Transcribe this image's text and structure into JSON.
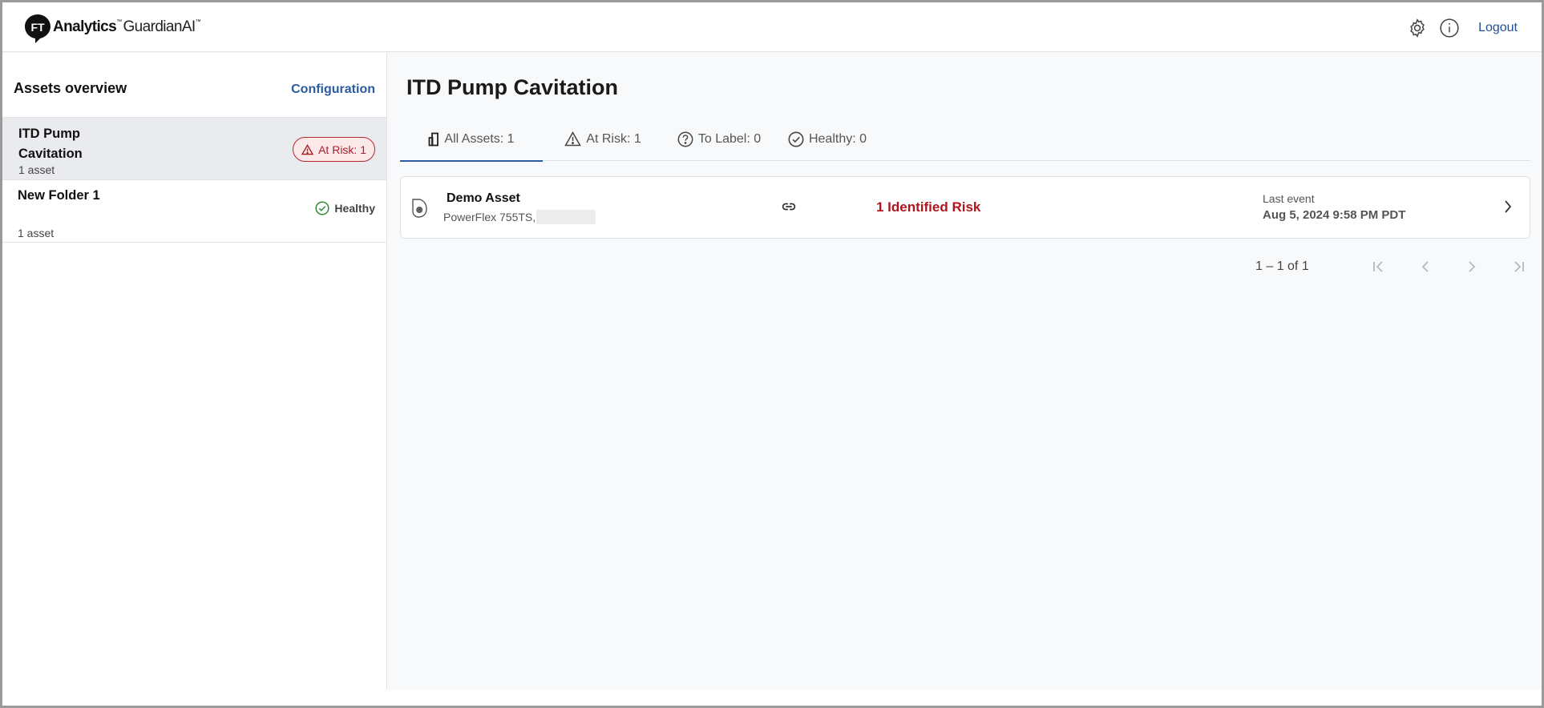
{
  "header": {
    "logo_badge": "FT",
    "logo_analytics": "Analytics",
    "logo_tm": "™",
    "logo_product": "GuardianAI",
    "logo_product_tm": "™",
    "settings_icon": "gear-icon",
    "info_icon": "info-icon",
    "logout_label": "Logout"
  },
  "sidebar": {
    "title": "Assets overview",
    "config_label": "Configuration",
    "folders": [
      {
        "name": "ITD Pump Cavitation",
        "count": "1 asset",
        "status_label": "At Risk: 1",
        "status": "at-risk",
        "selected": true
      },
      {
        "name": "New Folder 1",
        "count": "1 asset",
        "status_label": "Healthy",
        "status": "healthy",
        "selected": false
      }
    ]
  },
  "main": {
    "title": "ITD Pump Cavitation",
    "tabs": [
      {
        "label": "All Assets: 1",
        "icon": "building-icon",
        "active": true
      },
      {
        "label": "At Risk: 1",
        "icon": "warning-icon",
        "active": false
      },
      {
        "label": "To Label: 0",
        "icon": "question-icon",
        "active": false
      },
      {
        "label": "Healthy: 0",
        "icon": "check-circle-icon",
        "active": false
      }
    ],
    "assets": [
      {
        "name": "Demo Asset",
        "model": "PowerFlex 755TS,",
        "risk_label": "1 Identified Risk",
        "last_event_label": "Last event",
        "last_event_value": "Aug 5, 2024 9:58 PM PDT"
      }
    ],
    "pagination": {
      "range": "1 – 1 of 1"
    }
  },
  "colors": {
    "accent": "#2a5aa0",
    "risk": "#b0141c",
    "healthy": "#2e8b3a",
    "selected_bg": "#e9ebee"
  }
}
